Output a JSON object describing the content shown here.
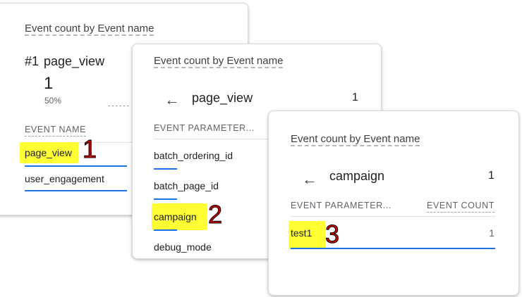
{
  "card1": {
    "title": "Event count by Event name",
    "rank": "#1",
    "top_event": "page_view",
    "value": "1",
    "percent": "50%",
    "column_header": "EVENT NAME",
    "rows": [
      {
        "label": "page_view"
      },
      {
        "label": "user_engagement"
      }
    ],
    "annotation": "1"
  },
  "card2": {
    "title": "Event count by Event name",
    "back_label": "page_view",
    "back_value": "1",
    "column_header": "EVENT PARAMETER...",
    "rows": [
      {
        "label": "batch_ordering_id"
      },
      {
        "label": "batch_page_id"
      },
      {
        "label": "campaign"
      },
      {
        "label": "debug_mode"
      }
    ],
    "annotation": "2"
  },
  "card3": {
    "title": "Event count by Event name",
    "back_label": "campaign",
    "back_value": "1",
    "column_header_left": "EVENT PARAMETER...",
    "column_header_right": "EVENT COUNT",
    "rows": [
      {
        "label": "test1",
        "value": "1"
      }
    ],
    "annotation": "3"
  },
  "colors": {
    "highlight": "#ffff33",
    "bar": "#1a73e8",
    "annotation": "#d50000"
  },
  "icons": [
    "back-arrow-icon"
  ]
}
